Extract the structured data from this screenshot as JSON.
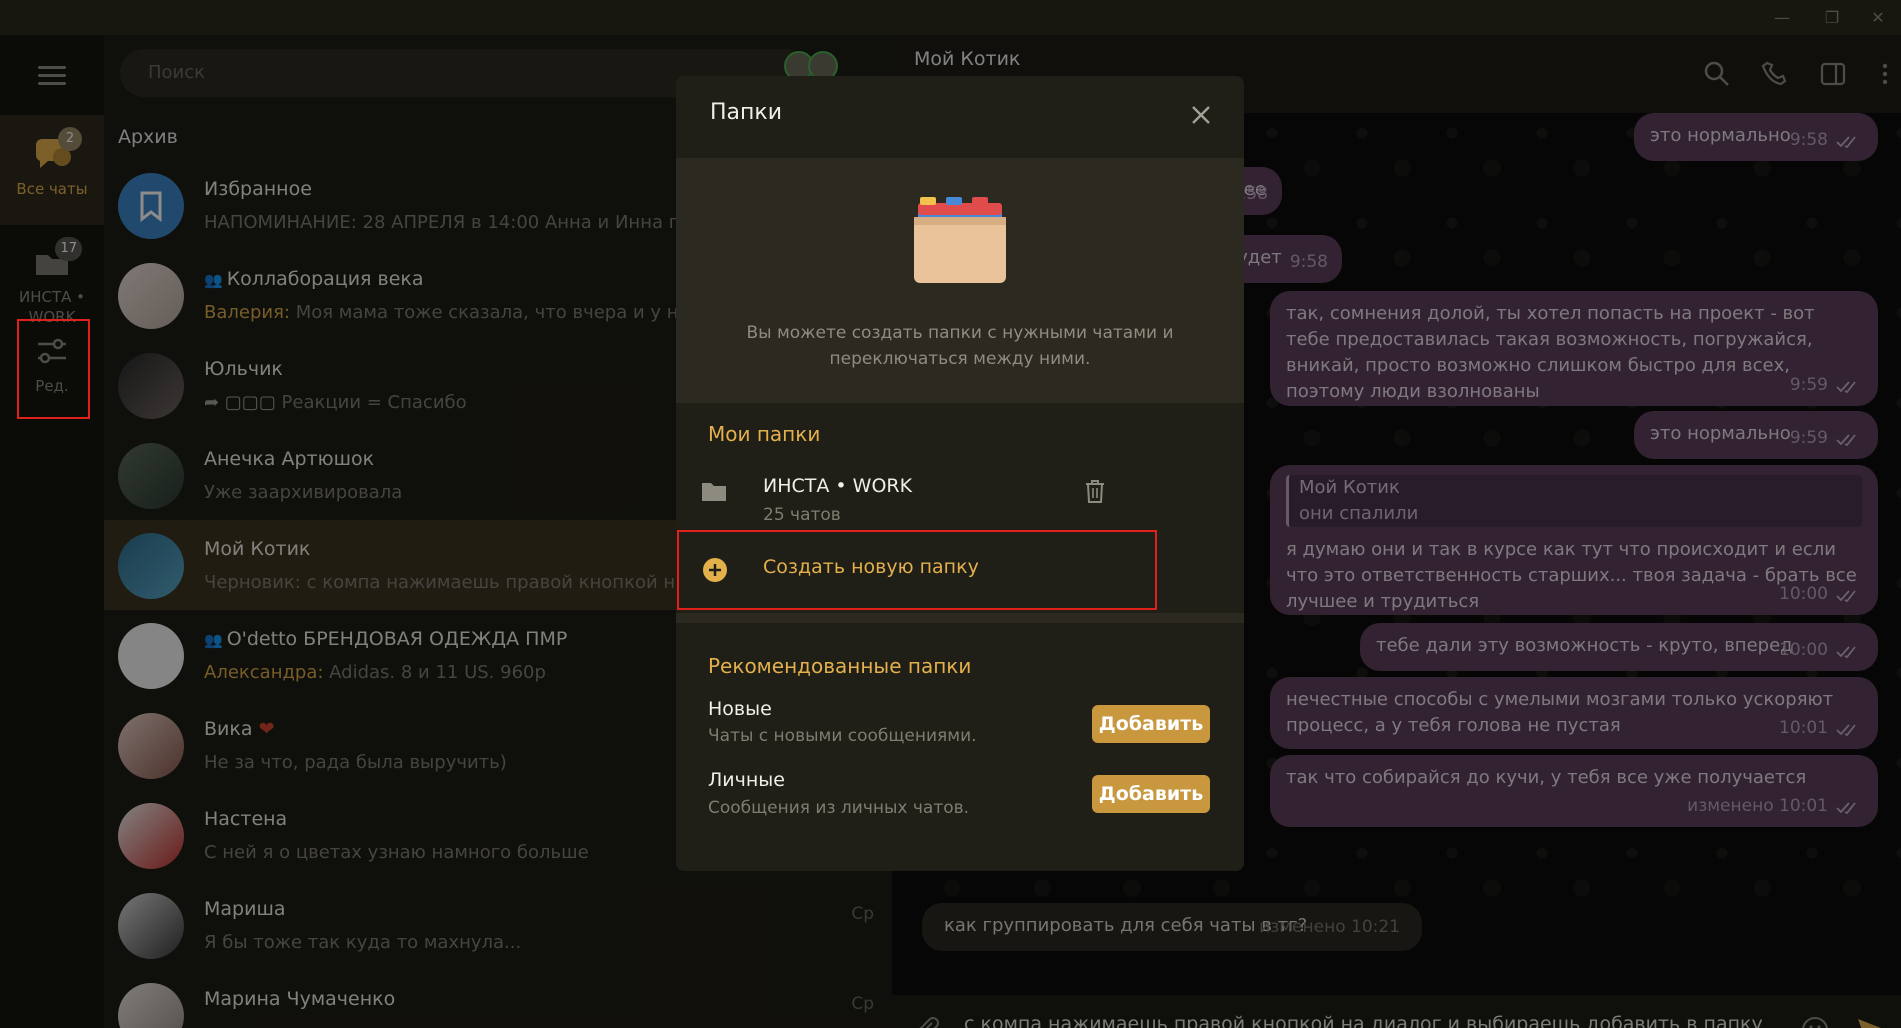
{
  "window": {
    "controls": [
      "—",
      "❐",
      "✕"
    ]
  },
  "rail": {
    "items": [
      {
        "label": "Все чаты",
        "badge": "2",
        "active": true
      },
      {
        "label": "ИНСТА • WORK",
        "badge": "17",
        "active": false
      },
      {
        "label": "Ред.",
        "badge": "",
        "active": false
      }
    ]
  },
  "chatlist": {
    "search_placeholder": "Поиск",
    "archive_label": "Архив",
    "chats": [
      {
        "name": "Избранное",
        "sender": "",
        "preview": "НАПОМИНАНИЕ: 28 АПРЕЛЯ в 14:00 Анна и Инна п",
        "time": "",
        "group": false
      },
      {
        "name": "Коллаборация века",
        "sender": "Валерия:",
        "preview": " Моя мама тоже сказала, что вчера и у не",
        "time": "",
        "group": true
      },
      {
        "name": "Юльчик",
        "sender": "",
        "preview": "Реакции = Спасибо",
        "time": "",
        "group": false
      },
      {
        "name": "Анечка Артюшок",
        "sender": "",
        "preview": "Уже заархивировала",
        "time": "",
        "group": false
      },
      {
        "name": "Мой Котик",
        "sender": "",
        "preview": "Черновик: с компа нажимаешь правой кнопкой на",
        "time": "",
        "group": false
      },
      {
        "name": "O'detto БРЕНДОВАЯ ОДЕЖДА ПМР",
        "sender": "Александра:",
        "preview": " Adidas. 8 и 11 US. 960р",
        "time": "",
        "group": true
      },
      {
        "name": "Вика",
        "sender": "",
        "preview": "Не за что, рада была выручить)",
        "time": "",
        "group": false
      },
      {
        "name": "Настена",
        "sender": "",
        "preview": "С ней я о цветах узнаю намного больше",
        "time": "",
        "group": false
      },
      {
        "name": "Мариша",
        "sender": "",
        "preview": "Я бы тоже так куда то махнула...",
        "time": "Ср",
        "group": false
      },
      {
        "name": "Марина Чумаченко",
        "sender": "",
        "preview": "",
        "time": "Ср",
        "group": false
      }
    ]
  },
  "chat": {
    "title": "Мой Котик",
    "messages": [
      {
        "text": "это нормально",
        "time": "9:58"
      },
      {
        "text": "нее",
        "time": "9:58"
      },
      {
        "text": "будет",
        "time": "9:58"
      },
      {
        "text": "так, сомнения долой, ты хотел попасть на проект - вот тебе предоставилась такая возможность, погружайся, вникай, просто возможно слишком быстро для всех, поэтому люди взолнованы",
        "time": "9:59"
      },
      {
        "text": "это нормально",
        "time": "9:59"
      },
      {
        "reply_name": "Мой Котик",
        "reply_text": "они спалили",
        "text": "я думаю они и так в курсе как тут что происходит и если что это ответственность старших... твоя задача - брать все лучшее и трудиться",
        "time": "10:00"
      },
      {
        "text": "тебе дали эту возможность - круто, вперед",
        "time": "10:00"
      },
      {
        "text": "нечестные способы с умелыми мозгами только ускоряют процесс, а у тебя голова не пустая",
        "time": "10:01"
      },
      {
        "text": "так что собирайся до кучи, у тебя все уже получается",
        "time": "изменено 10:01"
      }
    ],
    "incoming": {
      "text": "как группировать для себя чаты в тг?",
      "time": "изменено 10:21"
    },
    "composer_text": "с компа нажимаешь правой кнопкой на диалог и выбираешь добавить в папку"
  },
  "dialog": {
    "title": "Папки",
    "description": "Вы можете создать папки с нужными чатами и переключаться между ними.",
    "my_folders_title": "Мои папки",
    "folders": [
      {
        "name": "ИНСТА • WORK",
        "count": "25 чатов"
      }
    ],
    "create_label": "Создать новую папку",
    "recommended_title": "Рекомендованные папки",
    "recommended": [
      {
        "name": "Новые",
        "desc": "Чаты с новыми сообщениями.",
        "button": "Добавить"
      },
      {
        "name": "Личные",
        "desc": "Сообщения из личных чатов.",
        "button": "Добавить"
      }
    ]
  },
  "colors": {
    "accent": "#e3b04b",
    "bubble": "#5b3e5c",
    "highlight_frame": "#e0201a",
    "button": "#c8973e"
  }
}
